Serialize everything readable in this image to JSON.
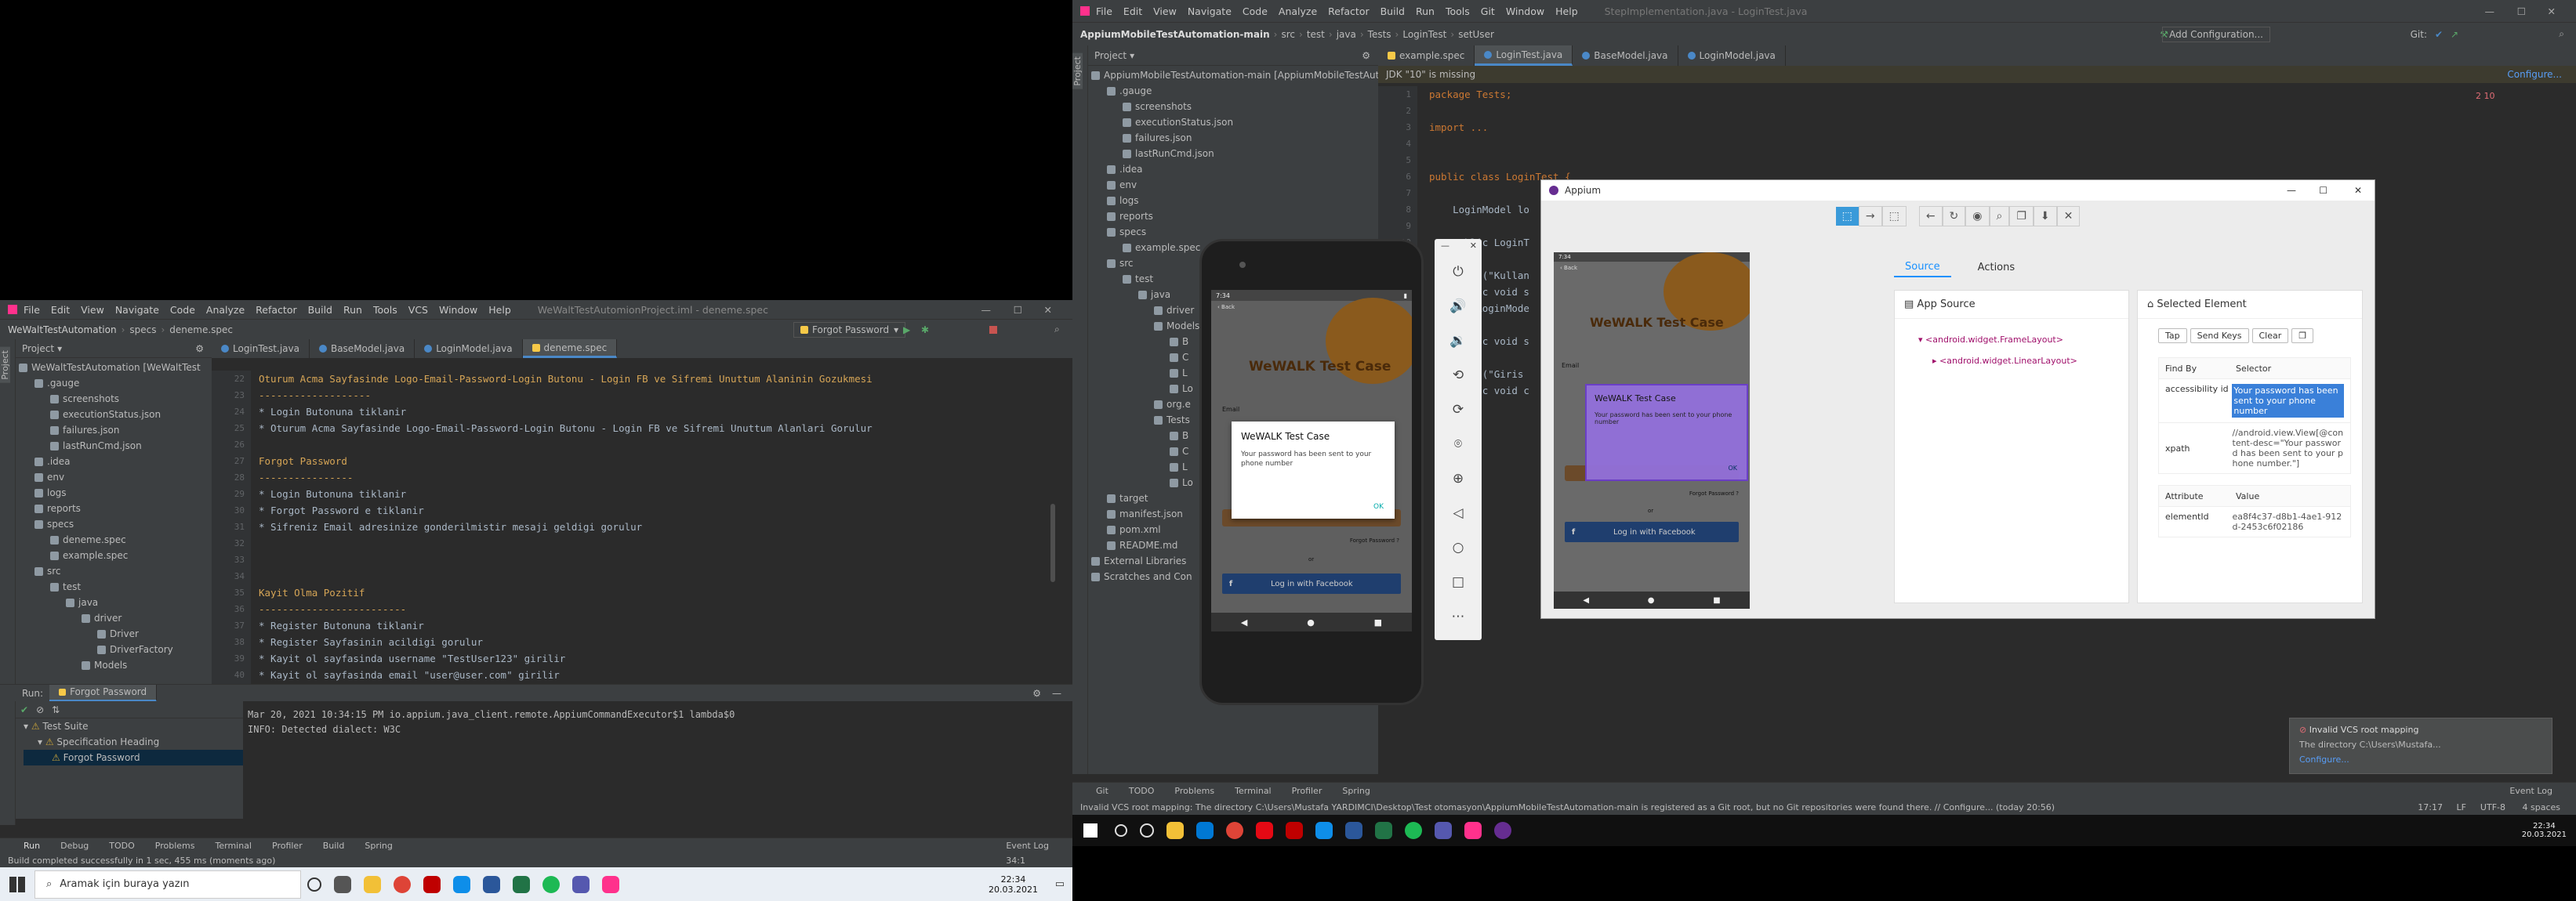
{
  "left_ide": {
    "menu": [
      "File",
      "Edit",
      "View",
      "Navigate",
      "Code",
      "Analyze",
      "Refactor",
      "Build",
      "Run",
      "Tools",
      "VCS",
      "Window",
      "Help"
    ],
    "window_title": "WeWaltTestAutomionProject.iml - deneme.spec",
    "breadcrumb": [
      "WeWaltTestAutomation",
      "specs",
      "deneme.spec"
    ],
    "run_config": "Forgot Password",
    "project_label": "Project",
    "tabs": [
      "LoginTest.java",
      "BaseModel.java",
      "LoginModel.java",
      "deneme.spec"
    ],
    "tree": [
      "WeWaltTestAutomation [WeWaltTest",
      ".gauge",
      "screenshots",
      "executionStatus.json",
      "failures.json",
      "lastRunCmd.json",
      ".idea",
      "env",
      "logs",
      "reports",
      "specs",
      "deneme.spec",
      "example.spec",
      "src",
      "test",
      "java",
      "driver",
      "Driver",
      "DriverFactory",
      "Models"
    ],
    "line_numbers": [
      "22",
      "23",
      "24",
      "25",
      "26",
      "27",
      "28",
      "29",
      "30",
      "31",
      "32",
      "33",
      "34",
      "35",
      "36",
      "37",
      "38",
      "39",
      "40"
    ],
    "code_lines": [
      "Oturum Acma Sayfasinde Logo-Email-Password-Login Butonu - Login FB ve Sifremi Unuttum Alaninin Gozukmesi",
      "-------------------",
      "* Login Butonuna tiklanir",
      "* Oturum Acma Sayfasinde Logo-Email-Password-Login Butonu - Login FB ve Sifremi Unuttum Alanlari Gorulur",
      "",
      "Forgot Password",
      "----------------",
      "* Login Butonuna tiklanir",
      "* Forgot Password e tiklanir",
      "* Sifreniz Email adresinize gonderilmistir mesaji geldigi gorulur",
      "",
      "",
      "",
      "Kayit Olma Pozitif",
      "-------------------------",
      "* Register Butonuna tiklanir",
      "* Register Sayfasinin acildigi gorulur",
      "* Kayit ol sayfasinda username \"TestUser123\" girilir",
      "* Kayit ol sayfasinda email \"user@user.com\" girilir"
    ],
    "run_label": "Run:",
    "run_tab": "Forgot Password",
    "test_tree": [
      "Test Suite",
      "Specification Heading",
      "Forgot Password"
    ],
    "console": [
      "Mar 20, 2021 10:34:15 PM io.appium.java_client.remote.AppiumCommandExecutor$1 lambda$0",
      "INFO: Detected dialect: W3C"
    ],
    "bottom_tabs": [
      "Run",
      "Debug",
      "TODO",
      "Problems",
      "Terminal",
      "Profiler",
      "Build",
      "Spring"
    ],
    "event_log": "Event Log",
    "status": "Build completed successfully in 1 sec, 455 ms (moments ago)",
    "cursor_pos": "34:1"
  },
  "left_taskbar": {
    "search_placeholder": "Aramak için buraya yazın",
    "time": "22:34",
    "date": "20.03.2021"
  },
  "right_ide": {
    "menu": [
      "File",
      "Edit",
      "View",
      "Navigate",
      "Code",
      "Analyze",
      "Refactor",
      "Build",
      "Run",
      "Tools",
      "Git",
      "Window",
      "Help"
    ],
    "window_title": "StepImplementation.java - LoginTest.java",
    "breadcrumb": [
      "AppiumMobileTestAutomation-main",
      "src",
      "test",
      "java",
      "Tests",
      "LoginTest",
      "setUser"
    ],
    "add_config": "Add Configuration...",
    "git_label": "Git:",
    "project_label": "Project",
    "tabs": [
      "example.spec",
      "LoginTest.java",
      "BaseModel.java",
      "LoginModel.java"
    ],
    "jdk_warning": "JDK \"10\" is missing",
    "configure": "Configure...",
    "problems": "2  10",
    "tree": [
      "AppiumMobileTestAutomation-main [AppiumMobileTestAutomation]",
      ".gauge",
      "screenshots",
      "executionStatus.json",
      "failures.json",
      "lastRunCmd.json",
      ".idea",
      "env",
      "logs",
      "reports",
      "specs",
      "example.spec",
      "src",
      "test",
      "java",
      "driver",
      "Models",
      "B",
      "C",
      "L",
      "Lo",
      "org.e",
      "Tests",
      "B",
      "C",
      "L",
      "Lo",
      "target",
      "manifest.json",
      "pom.xml",
      "README.md",
      "External Libraries",
      "Scratches and Con"
    ],
    "line_numbers": [
      "1",
      "2",
      "3",
      "4",
      "5",
      "6",
      "7",
      "8",
      "9",
      "10",
      "11",
      "12",
      "13",
      "14",
      "15",
      "16",
      "17",
      "18",
      "19"
    ],
    "code_lines": [
      "package Tests;",
      "",
      "import ...",
      "",
      "",
      "public class LoginTest {",
      "",
      "    LoginModel lo",
      "",
      "    public LoginT",
      "",
      "        p(\"Kullan",
      "        ic void s",
      "        LoginMode",
      "",
      "        ic void s",
      "",
      "        p(\"Giris",
      "        ic void c"
    ],
    "bottom_tabs": [
      "Git",
      "TODO",
      "Problems",
      "Terminal",
      "Profiler",
      "Spring"
    ],
    "event_log": "Event Log",
    "status": "Invalid VCS root mapping: The directory C:\\Users\\Mustafa YARDIMCI\\Desktop\\Test otomasyon\\AppiumMobileTestAutomation-main is registered as a Git root, but no Git repositories were found there. // Configure... (today 20:56)",
    "status_right": [
      "17:17",
      "LF",
      "UTF-8",
      "4 spaces"
    ],
    "notification": {
      "title": "Invalid VCS root mapping",
      "body": "The directory C:\\Users\\Mustafa...",
      "link": "Configure..."
    }
  },
  "emulator": {
    "status_time": "7:34",
    "app_title": "WeWALK Test Case",
    "dialog_title": "WeWALK Test Case",
    "dialog_body": "Your password has been sent to your phone number",
    "dialog_ok": "OK",
    "email_label": "Email",
    "forgot": "Forgot Password ?",
    "or": "or",
    "fb_button": "Log in with Facebook",
    "back_label": "Back"
  },
  "appium": {
    "title": "Appium",
    "tabs": [
      "Source",
      "Actions"
    ],
    "app_source": "App Source",
    "selected_element": "Selected Element",
    "nodes": [
      "<android.widget.FrameLayout>",
      "<android.widget.LinearLayout>"
    ],
    "actions": [
      "Tap",
      "Send Keys",
      "Clear"
    ],
    "find_by_header": "Find By",
    "selector_header": "Selector",
    "rows": [
      {
        "find_by": "accessibility id",
        "selector": "Your password has been sent to your phone number"
      },
      {
        "find_by": "xpath",
        "selector": "//android.view.View[@content-desc=\"Your password has been sent to your phone number.\"]"
      }
    ],
    "attr_header": "Attribute",
    "value_header": "Value",
    "attr_rows": [
      {
        "attribute": "elementId",
        "value": "ea8f4c37-d8b1-4ae1-912d-2453c6f02186"
      }
    ]
  },
  "right_taskbar": {
    "time": "22:34",
    "date": "20.03.2021"
  }
}
